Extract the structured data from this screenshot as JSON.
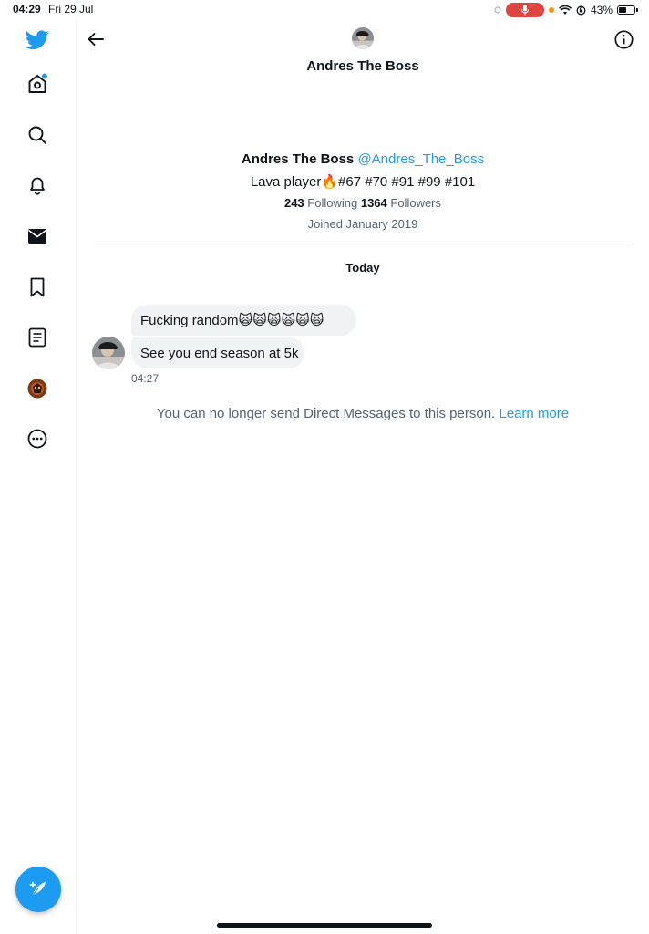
{
  "status_bar": {
    "time": "04:29",
    "date": "Fri 29 Jul",
    "battery_text": "43%",
    "battery_level": 0.43,
    "mic_color": "#e0443e",
    "dot_color": "#ff9500"
  },
  "sidebar": {
    "icons": [
      "twitter-logo",
      "home-icon",
      "search-icon",
      "notifications-icon",
      "messages-icon",
      "bookmarks-icon",
      "lists-icon",
      "profile-avatar",
      "more-icon"
    ],
    "accent": "#1d9bf0",
    "compose_icon": "compose-feather-icon"
  },
  "header": {
    "name": "Andres The Boss"
  },
  "profile": {
    "name": "Andres The Boss",
    "handle": "@Andres_The_Boss",
    "bio": "Lava player🔥#67 #70 #91 #99 #101",
    "following_count": "243",
    "following_label": "Following",
    "followers_count": "1364",
    "followers_label": "Followers",
    "joined": "Joined January 2019"
  },
  "conversation": {
    "day_label": "Today",
    "messages": [
      {
        "text": "Fucking random🙀🙀🙀🙀🙀🙀"
      },
      {
        "text": "See you end season at 5k"
      }
    ],
    "time": "04:27",
    "notice_text": "You can no longer send Direct Messages to this person.",
    "notice_link": "Learn more"
  }
}
